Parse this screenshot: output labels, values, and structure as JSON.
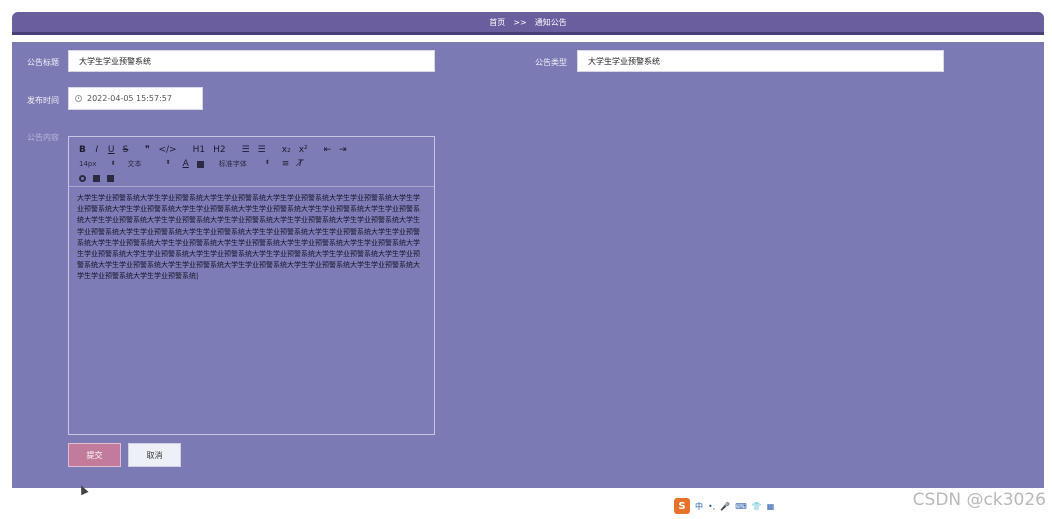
{
  "breadcrumb": {
    "home": "首页",
    "separator": ">>",
    "current": "通知公告"
  },
  "form": {
    "title_label": "公告标题",
    "title_value": "大学生学业预警系统",
    "type_label": "公告类型",
    "type_value": "大学生学业预警系统",
    "time_label": "发布时间",
    "time_value": "2022-04-05 15:57:57",
    "content_label": "公告内容"
  },
  "editor": {
    "toolbar_row1": [
      "B",
      "I",
      "U",
      "S",
      "❞",
      "</>",
      "H1",
      "H2",
      "☰",
      "☰",
      "x₂",
      "x²",
      "⇤",
      "⇥"
    ],
    "font_size": "14px",
    "text_style": "文本",
    "font_family": "标准字体",
    "toolbar_row3_icons": [
      "link-icon",
      "image-icon",
      "video-icon"
    ],
    "content": "大学生学业预警系统大学生学业预警系统大学生学业预警系统大学生学业预警系统大学生学业预警系统大学生学业预警系统大学生学业预警系统大学生学业预警系统大学生学业预警系统大学生学业预警系统大学生学业预警系统大学生学业预警系统大学生学业预警系统大学生学业预警系统大学生学业预警系统大学生学业预警系统大学生学业预警系统大学生学业预警系统大学生学业预警系统大学生学业预警系统大学生学业预警系统大学生学业预警系统大学生学业预警系统大学生学业预警系统大学生学业预警系统大学生学业预警系统大学生学业预警系统大学生学业预警系统大学生学业预警系统大学生学业预警系统大学生学业预警系统大学生学业预警系统大学生学业预警系统大学生学业预警系统大学生学业预警系统大学生学业预警系统大学生学业预警系统大学生学业预警系统大学生学业预警系统大学生学业预警系统|"
  },
  "buttons": {
    "submit": "提交",
    "cancel": "取消"
  },
  "ime": {
    "logo": "S",
    "items": [
      "中",
      "•,",
      "🎤",
      "⌨",
      "👕",
      "▦"
    ]
  },
  "watermark": "CSDN @ck3026",
  "colors": {
    "header": "#6b5e9e",
    "panel": "#7c7ab5",
    "submit": "#c27b9b"
  }
}
